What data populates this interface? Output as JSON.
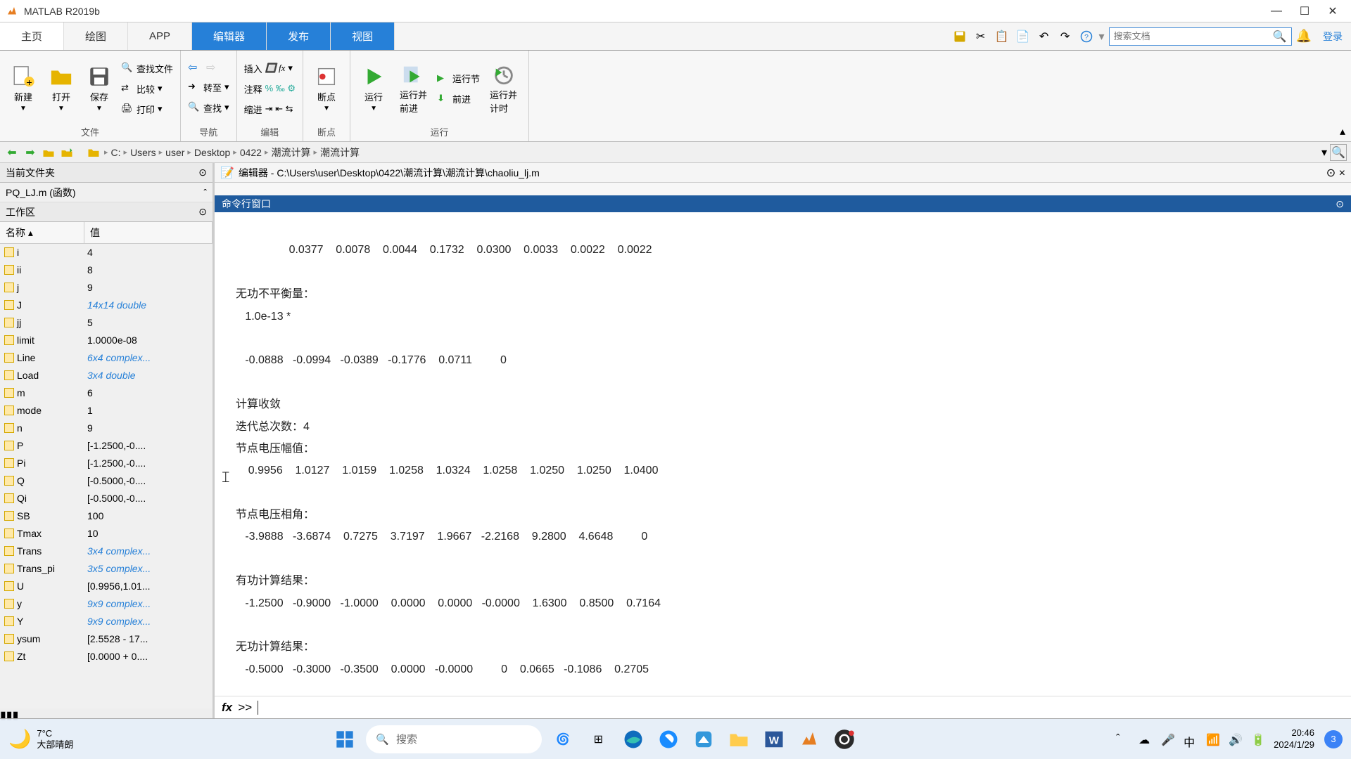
{
  "titlebar": {
    "title": "MATLAB R2019b"
  },
  "tabs": [
    "主页",
    "绘图",
    "APP",
    "编辑器",
    "发布",
    "视图"
  ],
  "search_placeholder": "搜索文档",
  "login_label": "登录",
  "ribbon": {
    "group_file": {
      "new": "新建",
      "open": "打开",
      "save": "保存",
      "findfiles": "查找文件",
      "compare": "比较",
      "print": "打印",
      "label": "文件"
    },
    "group_nav": {
      "goto": "转至",
      "find": "查找",
      "label": "导航"
    },
    "group_edit": {
      "insert": "插入",
      "comment": "注释",
      "indent": "缩进",
      "label": "编辑"
    },
    "group_bp": {
      "bp": "断点",
      "label": "断点"
    },
    "group_run": {
      "run": "运行",
      "run_adv": "运行并\n前进",
      "run_sec": "运行节",
      "adv": "前进",
      "run_time": "运行并\n计时",
      "label": "运行"
    }
  },
  "breadcrumbs": [
    "C:",
    "Users",
    "user",
    "Desktop",
    "0422",
    "潮流计算",
    "潮流计算"
  ],
  "current_folder_label": "当前文件夹",
  "file_item": "PQ_LJ.m  (函数)",
  "workspace_label": "工作区",
  "ws_cols": {
    "name": "名称",
    "value": "值"
  },
  "ws_rows": [
    {
      "n": "i",
      "v": "4",
      "link": false
    },
    {
      "n": "ii",
      "v": "8",
      "link": false
    },
    {
      "n": "j",
      "v": "9",
      "link": false
    },
    {
      "n": "J",
      "v": "14x14 double",
      "link": true
    },
    {
      "n": "jj",
      "v": "5",
      "link": false
    },
    {
      "n": "limit",
      "v": "1.0000e-08",
      "link": false
    },
    {
      "n": "Line",
      "v": "6x4 complex...",
      "link": true
    },
    {
      "n": "Load",
      "v": "3x4 double",
      "link": true
    },
    {
      "n": "m",
      "v": "6",
      "link": false
    },
    {
      "n": "mode",
      "v": "1",
      "link": false
    },
    {
      "n": "n",
      "v": "9",
      "link": false
    },
    {
      "n": "P",
      "v": "[-1.2500,-0....",
      "link": false
    },
    {
      "n": "Pi",
      "v": "[-1.2500,-0....",
      "link": false
    },
    {
      "n": "Q",
      "v": "[-0.5000,-0....",
      "link": false
    },
    {
      "n": "Qi",
      "v": "[-0.5000,-0....",
      "link": false
    },
    {
      "n": "SB",
      "v": "100",
      "link": false
    },
    {
      "n": "Tmax",
      "v": "10",
      "link": false
    },
    {
      "n": "Trans",
      "v": "3x4 complex...",
      "link": true
    },
    {
      "n": "Trans_pi",
      "v": "3x5 complex...",
      "link": true
    },
    {
      "n": "U",
      "v": "[0.9956,1.01...",
      "link": false
    },
    {
      "n": "y",
      "v": "9x9 complex...",
      "link": true
    },
    {
      "n": "Y",
      "v": "9x9 complex...",
      "link": true
    },
    {
      "n": "ysum",
      "v": "[2.5528 - 17...",
      "link": false
    },
    {
      "n": "Zt",
      "v": "[0.0000 + 0....",
      "link": false
    }
  ],
  "editor_title": "编辑器 - C:\\Users\\user\\Desktop\\0422\\潮流计算\\潮流计算\\chaoliu_lj.m",
  "cmdwin_label": "命令行窗口",
  "cmd_output": "    0.0377    0.0078    0.0044    0.1732    0.0300    0.0033    0.0022    0.0022\n\n无功不平衡量：\n   1.0e-13 *\n\n   -0.0888   -0.0994   -0.0389   -0.1776    0.0711         0\n\n计算收敛\n迭代总次数：4\n节点电压幅值：\n    0.9956    1.0127    1.0159    1.0258    1.0324    1.0258    1.0250    1.0250    1.0400\n\n节点电压相角：\n   -3.9888   -3.6874    0.7275    3.7197    1.9667   -2.2168    9.2800    4.6648         0\n\n有功计算结果：\n   -1.2500   -0.9000   -1.0000    0.0000    0.0000   -0.0000    1.6300    0.8500    0.7164\n\n无功计算结果：\n   -0.5000   -0.3000   -0.3500    0.0000   -0.0000         0    0.0665   -0.1086    0.2705\n",
  "prompt_fx": "fx",
  "prompt_sym": ">>",
  "taskbar": {
    "weather_temp": "7°C",
    "weather_desc": "大部晴朗",
    "search_placeholder": "搜索",
    "time": "20:46",
    "date": "2024/1/29",
    "notif_count": "3"
  }
}
